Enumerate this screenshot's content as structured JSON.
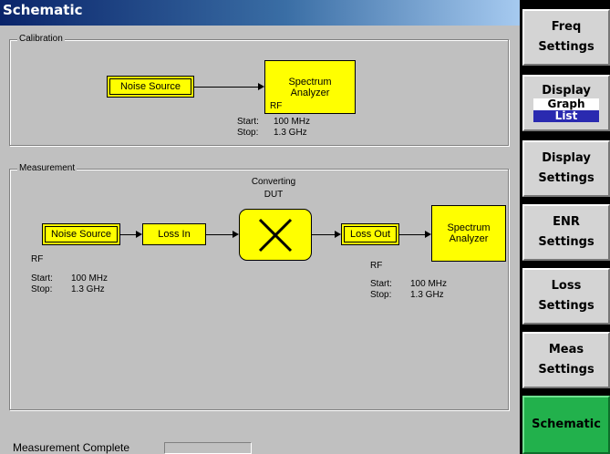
{
  "window": {
    "title": "Schematic"
  },
  "calibration": {
    "group_label": "Calibration",
    "noise_source": "Noise Source",
    "analyzer_line1": "Spectrum",
    "analyzer_line2": "Analyzer",
    "rf_label": "RF",
    "start_label": "Start:",
    "start_value": "100 MHz",
    "stop_label": "Stop:",
    "stop_value": "1.3 GHz"
  },
  "measurement": {
    "group_label": "Measurement",
    "dut_line1": "Converting",
    "dut_line2": "DUT",
    "noise_source": "Noise Source",
    "loss_in": "Loss In",
    "loss_out": "Loss Out",
    "analyzer_line1": "Spectrum",
    "analyzer_line2": "Analyzer",
    "input": {
      "rf_label": "RF",
      "start_label": "Start:",
      "start_value": "100 MHz",
      "stop_label": "Stop:",
      "stop_value": "1.3 GHz"
    },
    "output": {
      "rf_label": "RF",
      "start_label": "Start:",
      "start_value": "100 MHz",
      "stop_label": "Stop:",
      "stop_value": "1.3 GHz"
    }
  },
  "status": {
    "text": "Measurement Complete"
  },
  "softkeys": {
    "freq_line1": "Freq",
    "freq_line2": "Settings",
    "display_graph_line1": "Display",
    "display_graph_opt1": "Graph",
    "display_graph_opt2": "List",
    "display_graph_selected": "List",
    "display_settings_line1": "Display",
    "display_settings_line2": "Settings",
    "enr_line1": "ENR",
    "enr_line2": "Settings",
    "loss_line1": "Loss",
    "loss_line2": "Settings",
    "meas_line1": "Meas",
    "meas_line2": "Settings",
    "schematic": "Schematic"
  },
  "colors": {
    "block_fill": "#ffff00",
    "active_softkey": "#22b14c",
    "selected_option": "#2a2ab0"
  }
}
